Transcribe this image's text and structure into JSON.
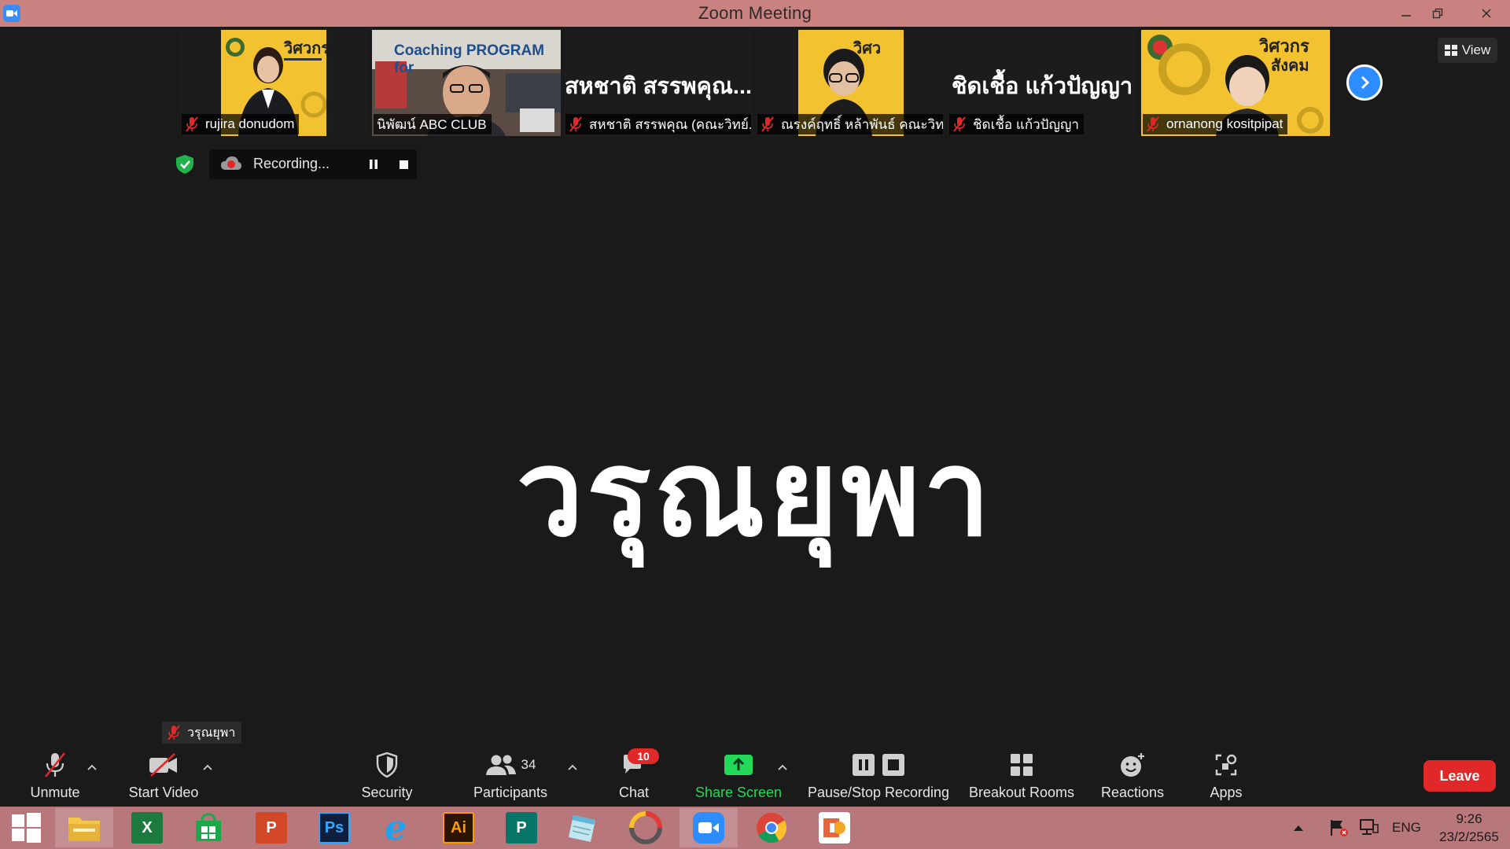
{
  "window": {
    "title": "Zoom Meeting"
  },
  "thumbnails": [
    {
      "name": "rujira donudom",
      "display": "photo"
    },
    {
      "name": "นิพัฒน์ ABC CLUB",
      "display": "photo",
      "banner": "Coaching PROGRAM for"
    },
    {
      "name": "สหชาติ สรรพคุณ (คณะวิทย์...",
      "display": "name",
      "big_name": "สหชาติ สรรพคุณ..."
    },
    {
      "name": "ณรงค์ฤทธิ์ หล้าพันธ์ คณะวิทย์",
      "display": "photo"
    },
    {
      "name": "ชิดเชื้อ แก้วปัญญา",
      "display": "name",
      "big_name": "ชิดเชื้อ แก้วปัญญา"
    },
    {
      "name": "ornanong kositpipat",
      "display": "photo"
    }
  ],
  "view_button": {
    "label": "View"
  },
  "recording": {
    "status": "Recording..."
  },
  "active_speaker": {
    "name": "วรุณยุพา"
  },
  "self_view": {
    "name": "วรุณยุพา"
  },
  "toolbar": {
    "unmute": "Unmute",
    "start_video": "Start Video",
    "security": "Security",
    "participants": "Participants",
    "participants_count": "34",
    "chat": "Chat",
    "chat_badge": "10",
    "share_screen": "Share Screen",
    "pause_stop_recording": "Pause/Stop Recording",
    "breakout_rooms": "Breakout Rooms",
    "reactions": "Reactions",
    "apps": "Apps",
    "leave": "Leave"
  },
  "taskbar": {
    "apps": [
      {
        "name": "file-explorer",
        "text": ""
      },
      {
        "name": "excel",
        "text": "X"
      },
      {
        "name": "store",
        "text": ""
      },
      {
        "name": "powerpoint",
        "text": "P"
      },
      {
        "name": "photoshop",
        "text": "Ps"
      },
      {
        "name": "internet-explorer",
        "text": "e"
      },
      {
        "name": "illustrator",
        "text": "Ai"
      },
      {
        "name": "publisher",
        "text": "P"
      },
      {
        "name": "notepad",
        "text": ""
      },
      {
        "name": "photoscape",
        "text": ""
      },
      {
        "name": "zoom",
        "text": ""
      },
      {
        "name": "chrome",
        "text": ""
      },
      {
        "name": "slides-app",
        "text": ""
      }
    ],
    "language": "ENG",
    "time": "9:26",
    "date": "23/2/2565"
  },
  "colors": {
    "title_bar": "#c9827f",
    "taskbar": "#b8777a",
    "zoom_blue": "#2d8cff",
    "leave_red": "#e02828",
    "share_green": "#23d959",
    "muted_red": "#e02828",
    "thumbnail_yellow": "#f2c230"
  }
}
